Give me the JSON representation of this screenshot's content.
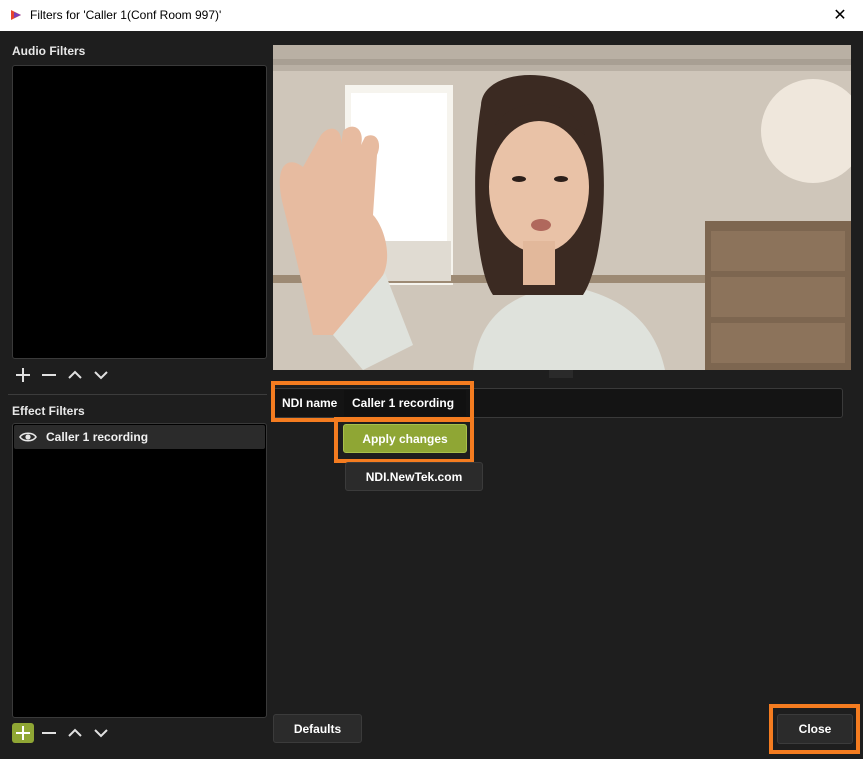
{
  "window": {
    "title": "Filters for 'Caller 1(Conf Room 997)'",
    "close_glyph": "✕"
  },
  "audio_filters": {
    "label": "Audio Filters",
    "items": []
  },
  "effect_filters": {
    "label": "Effect Filters",
    "items": [
      {
        "label": "Caller 1 recording",
        "visible": true
      }
    ]
  },
  "ndi": {
    "label": "NDI name",
    "value": "Caller 1 recording",
    "apply_label": "Apply changes",
    "link_label": "NDI.NewTek.com"
  },
  "footer": {
    "defaults_label": "Defaults",
    "close_label": "Close"
  },
  "colors": {
    "accent_green": "#8fa634",
    "highlight_orange": "#f47c20",
    "background": "#1e1e1e"
  }
}
